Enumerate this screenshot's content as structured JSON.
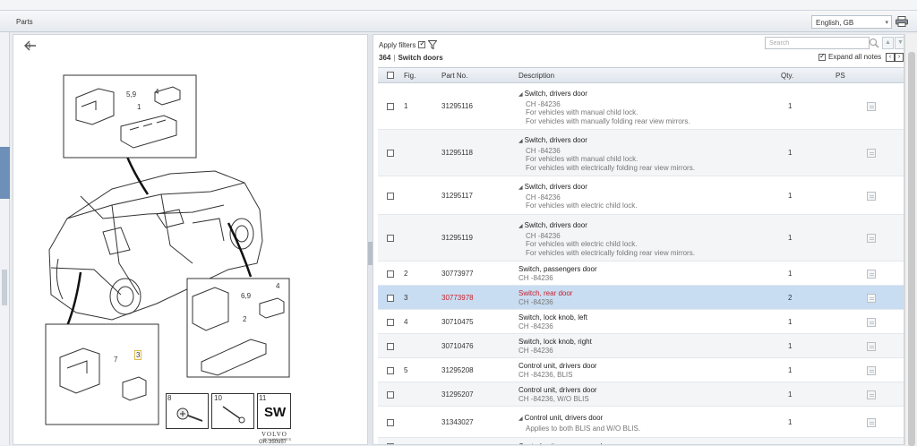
{
  "window": {
    "top_fragment": "",
    "title": "Parts"
  },
  "language": {
    "selected": "English, GB"
  },
  "search": {
    "placeholder": "Search"
  },
  "filters": {
    "apply_label": "Apply filters",
    "apply_checked": true
  },
  "breadcrumb": {
    "section": "364",
    "separator": "|",
    "name": "Switch doors"
  },
  "expand": {
    "label": "Expand all notes",
    "checked": true
  },
  "columns": {
    "fig": "Fig.",
    "part_no": "Part No.",
    "description": "Description",
    "qty": "Qty.",
    "ps": "PS"
  },
  "rows": [
    {
      "fig": "1",
      "part_no": "31295116",
      "head": "Switch, drivers door",
      "collapsible": true,
      "sub": [
        "CH -84236",
        "For vehicles with manual child lock.",
        "For vehicles with manually folding rear view mirrors."
      ],
      "qty": "1"
    },
    {
      "fig": "",
      "part_no": "31295118",
      "head": "Switch, drivers door",
      "collapsible": true,
      "sub": [
        "CH -84236",
        "For vehicles with manual child lock.",
        "For vehicles with electrically folding rear view mirrors."
      ],
      "qty": "1"
    },
    {
      "fig": "",
      "part_no": "31295117",
      "head": "Switch, drivers door",
      "collapsible": true,
      "sub": [
        "CH -84236",
        "For vehicles with electric child lock."
      ],
      "qty": "1"
    },
    {
      "fig": "",
      "part_no": "31295119",
      "head": "Switch, drivers door",
      "collapsible": true,
      "sub": [
        "CH -84236",
        "For vehicles with electric child lock.",
        "For vehicles with electrically folding rear view mirrors."
      ],
      "qty": "1"
    },
    {
      "fig": "2",
      "part_no": "30773977",
      "head": "Switch, passengers door",
      "collapsible": false,
      "sub": [
        "CH -84236"
      ],
      "qty": "1"
    },
    {
      "fig": "3",
      "part_no": "30773978",
      "head": "Switch, rear door",
      "collapsible": false,
      "sub": [
        "CH -84236"
      ],
      "qty": "2",
      "selected": true
    },
    {
      "fig": "4",
      "part_no": "30710475",
      "head": "Switch, lock knob, left",
      "collapsible": false,
      "sub": [
        "CH -84236"
      ],
      "qty": "1"
    },
    {
      "fig": "",
      "part_no": "30710476",
      "head": "Switch, lock knob, right",
      "collapsible": false,
      "sub": [
        "CH -84236"
      ],
      "qty": "1"
    },
    {
      "fig": "5",
      "part_no": "31295208",
      "head": "Control unit, drivers door",
      "collapsible": false,
      "sub": [
        "CH -84236, BLIS"
      ],
      "qty": "1"
    },
    {
      "fig": "",
      "part_no": "31295207",
      "head": "Control unit, drivers door",
      "collapsible": false,
      "sub": [
        "CH -84236, W/O BLIS"
      ],
      "qty": "1"
    },
    {
      "fig": "",
      "part_no": "31343027",
      "head": "Control unit, drivers door",
      "collapsible": true,
      "sub": [
        "Applies to both BLIS and W/O BLIS."
      ],
      "qty": "1"
    },
    {
      "fig": "",
      "part_no": "",
      "head": "Control unit, passengers door",
      "collapsible": false,
      "sub": [],
      "qty": ""
    }
  ],
  "diagram": {
    "labels": {
      "l1": "5,9",
      "l2": "4",
      "l3": "1",
      "l4": "6,9",
      "l5": "4",
      "l6": "2",
      "l7": "7",
      "l8": "3",
      "l9": "8",
      "l10": "10",
      "l11": "11",
      "sw": "SW"
    },
    "brand": "VOLVO",
    "brand_sub": "GENUINE PARTS",
    "ref": "GR-350957"
  }
}
